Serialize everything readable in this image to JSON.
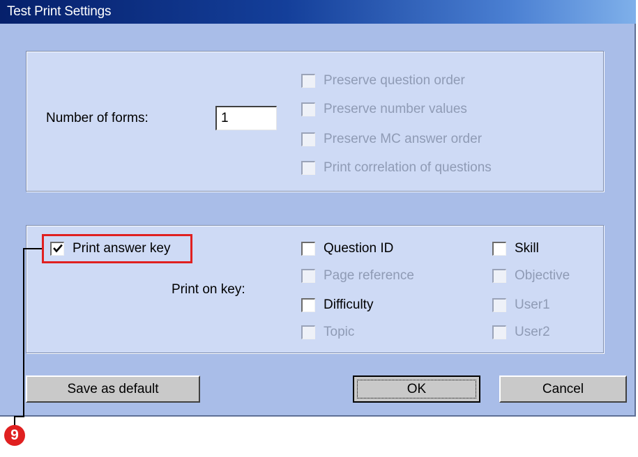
{
  "window": {
    "title": "Test Print Settings"
  },
  "forms": {
    "label": "Number of forms:",
    "value": "1",
    "options": [
      {
        "label": "Preserve question order",
        "checked": false,
        "enabled": false
      },
      {
        "label": "Preserve number values",
        "checked": false,
        "enabled": false
      },
      {
        "label": "Preserve MC answer order",
        "checked": false,
        "enabled": false
      },
      {
        "label": "Print correlation of questions",
        "checked": false,
        "enabled": false
      }
    ]
  },
  "key": {
    "print_answer_key": {
      "label": "Print answer key",
      "checked": true
    },
    "print_on_key_label": "Print on key:",
    "left_options": [
      {
        "label": "Question ID",
        "checked": false,
        "enabled": true
      },
      {
        "label": "Page reference",
        "checked": false,
        "enabled": false
      },
      {
        "label": "Difficulty",
        "checked": false,
        "enabled": true
      },
      {
        "label": "Topic",
        "checked": false,
        "enabled": false
      }
    ],
    "right_options": [
      {
        "label": "Skill",
        "checked": false,
        "enabled": true
      },
      {
        "label": "Objective",
        "checked": false,
        "enabled": false
      },
      {
        "label": "User1",
        "checked": false,
        "enabled": false
      },
      {
        "label": "User2",
        "checked": false,
        "enabled": false
      }
    ]
  },
  "buttons": {
    "save_default": "Save as default",
    "ok": "OK",
    "cancel": "Cancel"
  },
  "callout": {
    "number": "9",
    "color": "#e02020"
  }
}
